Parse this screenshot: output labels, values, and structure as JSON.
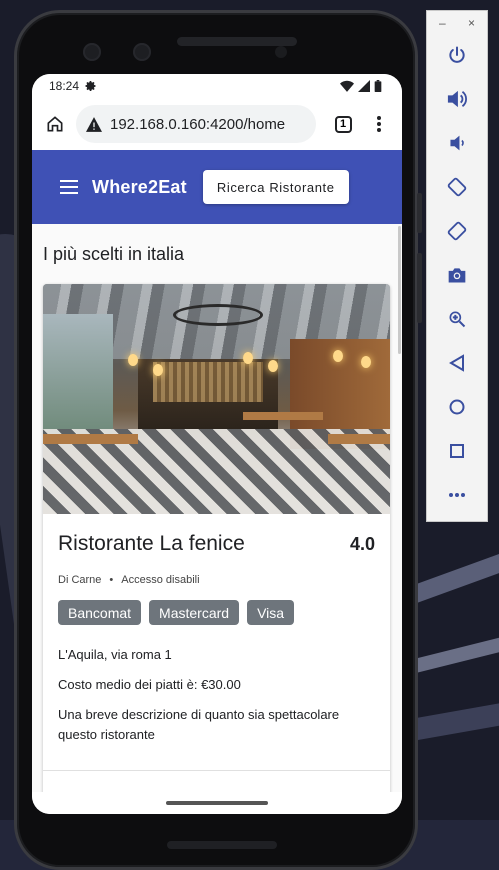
{
  "status_bar": {
    "time": "18:24"
  },
  "browser": {
    "url": "192.168.0.160:4200/home",
    "tab_count": "1"
  },
  "app": {
    "brand": "Where2Eat",
    "search_button_label": "Ricerca Ristorante",
    "section_title": "I più scelti in italia"
  },
  "restaurant": {
    "name": "Ristorante La fenice",
    "rating": "4.0",
    "category": "Di Carne",
    "separator": "•",
    "accessibility": "Accesso disabili",
    "payments": [
      "Bancomat",
      "Mastercard",
      "Visa"
    ],
    "address": "L'Aquila, via roma 1",
    "avg_cost": "Costo medio dei piatti è: €30.00",
    "description": "Una breve descrizione di quanto sia spettacolare questo ristorante"
  },
  "emulator_panel": {
    "minimize": "–",
    "close": "×",
    "buttons": [
      "power-icon",
      "volume-up-icon",
      "volume-down-icon",
      "rotate-left-icon",
      "rotate-right-icon",
      "camera-icon",
      "zoom-icon",
      "back-icon",
      "home-icon",
      "overview-icon",
      "more-icon"
    ]
  },
  "colors": {
    "toolbar": "#3f51b5",
    "chip": "#6e757c"
  }
}
